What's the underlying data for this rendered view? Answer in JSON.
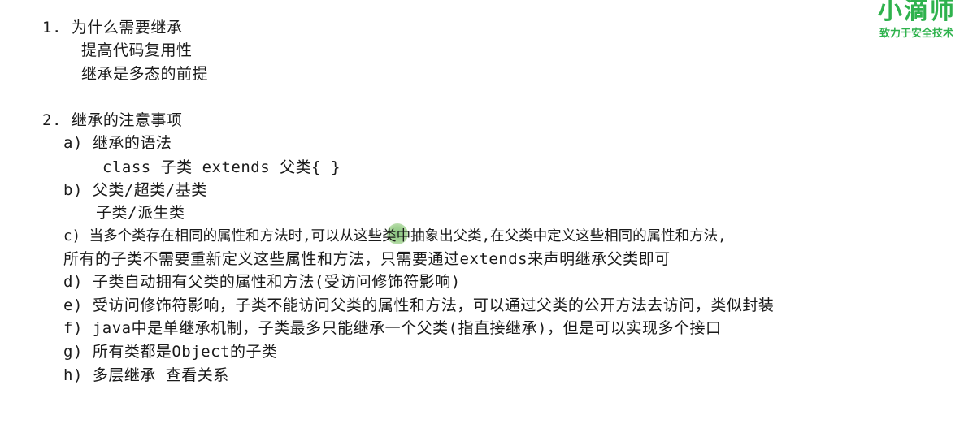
{
  "logo": {
    "mark": "小滴师",
    "slogan": "致力于安全技术"
  },
  "content": {
    "section1_title": "1. 为什么需要继承",
    "section1_item1": "提高代码复用性",
    "section1_item2": "继承是多态的前提",
    "section2_title": "2. 继承的注意事项",
    "a_title": "a) 继承的语法",
    "a_code": "class 子类 extends 父类{ }",
    "b_line1": "b) 父类/超类/基类",
    "b_line2": "子类/派生类",
    "c_line1": "c) 当多个类存在相同的属性和方法时,可以从这些类中抽象出父类,在父类中定义这些相同的属性和方法,",
    "c_line2": "所有的子类不需要重新定义这些属性和方法，只需要通过extends来声明继承父类即可",
    "d_line": "d) 子类自动拥有父类的属性和方法(受访问修饰符影响)",
    "e_line": "e) 受访问修饰符影响，子类不能访问父类的属性和方法，可以通过父类的公开方法去访问，类似封装",
    "f_line": "f) java中是单继承机制，子类最多只能继承一个父类(指直接继承)，但是可以实现多个接口",
    "g_line": "g) 所有类都是Object的子类",
    "h_line": "h) 多层继承  查看关系"
  }
}
